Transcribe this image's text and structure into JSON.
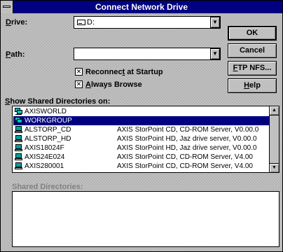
{
  "window": {
    "title": "Connect Network Drive"
  },
  "drive": {
    "label": "Drive:",
    "value": "D:"
  },
  "path": {
    "label": "Path:",
    "value": ""
  },
  "options": {
    "reconnect_label": "Reconnect at Startup",
    "reconnect_checked": true,
    "browse_label": "Always Browse",
    "browse_checked": true
  },
  "buttons": {
    "ok": "OK",
    "cancel": "Cancel",
    "ftp": "FTP NFS...",
    "help": "Help"
  },
  "shared_on": {
    "label": "Show Shared Directories on:",
    "rows": [
      {
        "name": "AXISWORLD",
        "desc": ""
      },
      {
        "name": "WORKGROUP",
        "desc": "",
        "selected": true
      },
      {
        "name": "ALSTORP_CD",
        "desc": "AXIS StorPoint CD, CD-ROM Server, V0.00.0"
      },
      {
        "name": "ALSTORP_HD",
        "desc": "AXIS StorPoint HD, Jaz drive server, V0.00.0"
      },
      {
        "name": "AXIS18024F",
        "desc": "AXIS StorPoint HD, Jaz drive server, V0.00.0"
      },
      {
        "name": "AXIS24E024",
        "desc": "AXIS StorPoint CD, CD-ROM Server, V4.00"
      },
      {
        "name": "AXIS280001",
        "desc": "AXIS StorPoint CD, CD-ROM Server, V4.00"
      }
    ]
  },
  "shared_dirs": {
    "label": "Shared Directories:"
  },
  "colors": {
    "titlebar": "#000080",
    "selection": "#000080",
    "face": "#c0c0c0"
  }
}
